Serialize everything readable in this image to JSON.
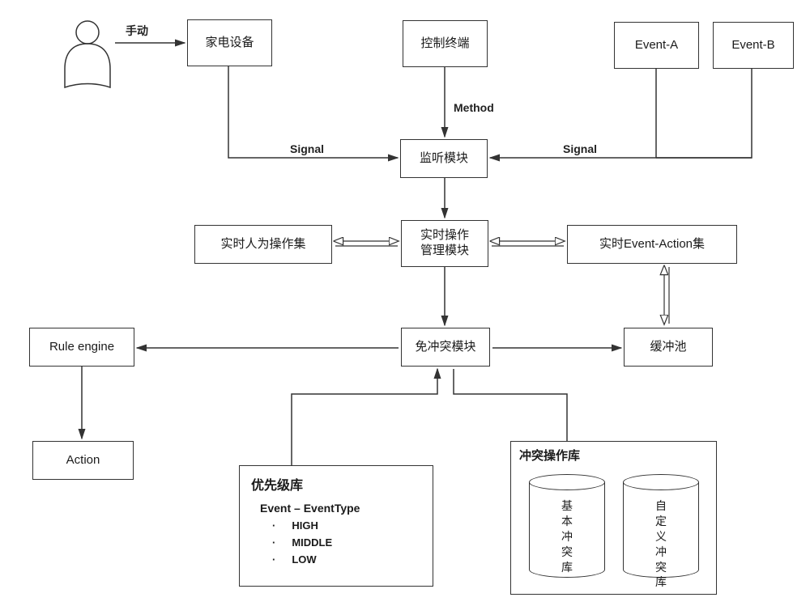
{
  "labels": {
    "manual": "手动",
    "signal_left": "Signal",
    "signal_right": "Signal",
    "method": "Method"
  },
  "boxes": {
    "person_alt": "user",
    "home_appliance": "家电设备",
    "control_terminal": "控制终端",
    "event_a": "Event-A",
    "event_b": "Event-B",
    "listener": "监听模块",
    "realtime_manager": "实时操作\n管理模块",
    "human_op_set": "实时人为操作集",
    "event_action_set": "实时Event-Action集",
    "conflict_free": "免冲突模块",
    "rule_engine": "Rule engine",
    "buffer_pool": "缓冲池",
    "action": "Action"
  },
  "priority": {
    "title": "优先级库",
    "event_line": "Event – EventType",
    "levels": [
      "HIGH",
      "MIDDLE",
      "LOW"
    ]
  },
  "conflict_lib": {
    "title": "冲突操作库",
    "basic": "基本冲突库",
    "custom": "自定义冲突库"
  }
}
